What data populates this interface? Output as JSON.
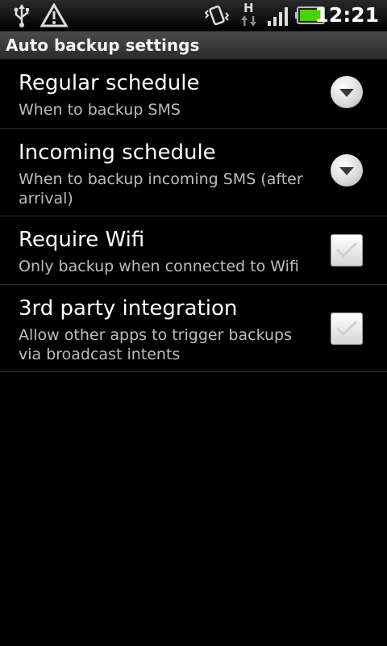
{
  "status_bar": {
    "time": "12:21",
    "network_label": "H",
    "battery_color": "#44d400",
    "icons": [
      "usb-icon",
      "warning-icon",
      "vibrate-icon",
      "data-arrows-icon",
      "signal-icon",
      "battery-icon"
    ]
  },
  "title_bar": {
    "title": "Auto backup settings"
  },
  "settings": {
    "items": [
      {
        "label": "Regular schedule",
        "summary": "When to backup SMS",
        "control": "dropdown"
      },
      {
        "label": "Incoming schedule",
        "summary": "When to backup incoming SMS (after arrival)",
        "control": "dropdown"
      },
      {
        "label": "Require Wifi",
        "summary": "Only backup when connected to Wifi",
        "control": "checkbox",
        "checked": false
      },
      {
        "label": "3rd party integration",
        "summary": "Allow other apps to trigger backups via broadcast intents",
        "control": "checkbox",
        "checked": false
      }
    ]
  }
}
